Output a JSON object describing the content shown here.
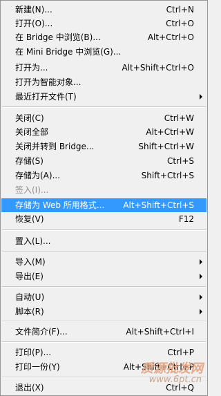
{
  "menu": {
    "items": [
      {
        "label": "新建(N)...",
        "shortcut": "Ctrl+N"
      },
      {
        "label": "打开(O)...",
        "shortcut": "Ctrl+O"
      },
      {
        "label": "在 Bridge 中浏览(B)...",
        "shortcut": "Alt+Ctrl+O"
      },
      {
        "label": "在 Mini Bridge 中浏览(G)...",
        "shortcut": ""
      },
      {
        "label": "打开为...",
        "shortcut": "Alt+Shift+Ctrl+O"
      },
      {
        "label": "打开为智能对象...",
        "shortcut": ""
      },
      {
        "label": "最近打开文件(T)",
        "shortcut": ""
      },
      {
        "label": "关闭(C)",
        "shortcut": "Ctrl+W"
      },
      {
        "label": "关闭全部",
        "shortcut": "Alt+Ctrl+W"
      },
      {
        "label": "关闭并转到 Bridge...",
        "shortcut": "Shift+Ctrl+W"
      },
      {
        "label": "存储(S)",
        "shortcut": "Ctrl+S"
      },
      {
        "label": "存储为(A)...",
        "shortcut": "Shift+Ctrl+S"
      },
      {
        "label": "签入(I)...",
        "shortcut": ""
      },
      {
        "label": "存储为 Web 所用格式...",
        "shortcut": "Alt+Shift+Ctrl+S"
      },
      {
        "label": "恢复(V)",
        "shortcut": "F12"
      },
      {
        "label": "置入(L)...",
        "shortcut": ""
      },
      {
        "label": "导入(M)",
        "shortcut": ""
      },
      {
        "label": "导出(E)",
        "shortcut": ""
      },
      {
        "label": "自动(U)",
        "shortcut": ""
      },
      {
        "label": "脚本(R)",
        "shortcut": ""
      },
      {
        "label": "文件简介(F)...",
        "shortcut": "Alt+Shift+Ctrl+I"
      },
      {
        "label": "打印(P)...",
        "shortcut": "Ctrl+P"
      },
      {
        "label": "打印一份(Y)",
        "shortcut": "Alt+Shift+Ctrl+P"
      },
      {
        "label": "退出(X)",
        "shortcut": "Ctrl+Q"
      }
    ]
  },
  "watermark": {
    "line1": "质源批发网",
    "line2": "www.6pt.cn"
  },
  "colors": {
    "highlight": "#3399ff",
    "background": "#f0f0f0",
    "disabled_text": "#8d8d8d"
  }
}
